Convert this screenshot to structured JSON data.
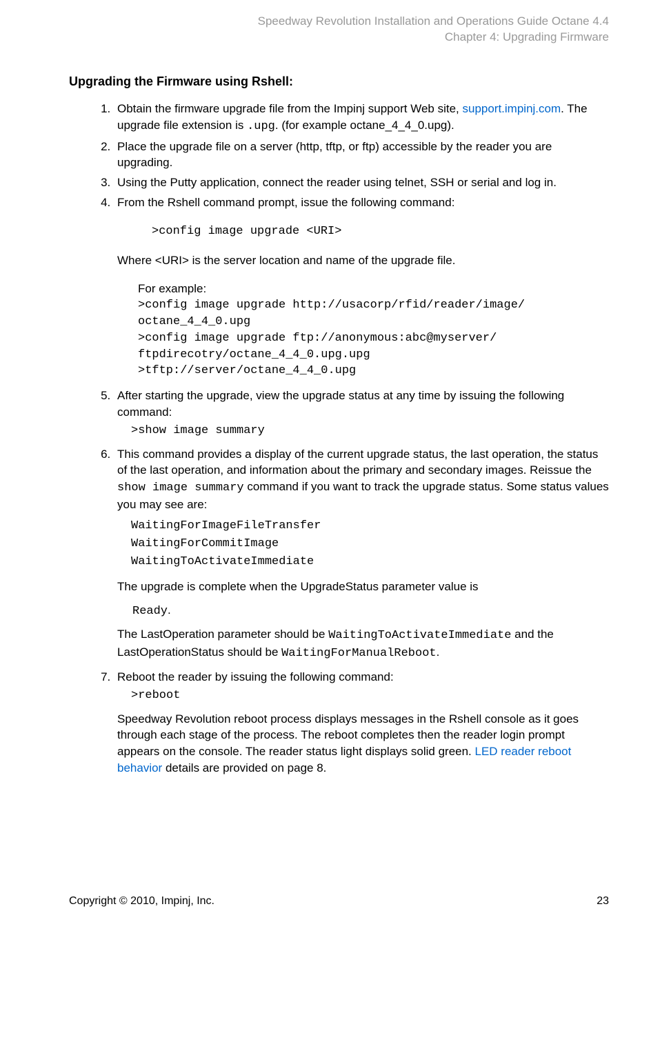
{
  "header": {
    "line1": "Speedway Revolution Installation and Operations Guide Octane 4.4",
    "line2": "Chapter 4: Upgrading Firmware"
  },
  "title": "Upgrading the Firmware using Rshell:",
  "steps": {
    "s1a": "Obtain the firmware upgrade file from the Impinj support Web site, ",
    "s1link": "support.impinj.com",
    "s1b": ". The upgrade file extension is ",
    "s1code": ".upg",
    "s1c": ". (for example octane_4_4_0.upg).",
    "s2": "Place the upgrade file on a server (http, tftp, or ftp) accessible by the reader you are upgrading.",
    "s3": "Using the Putty application, connect the reader using telnet, SSH or serial and log in.",
    "s4": "From the Rshell command prompt, issue the following command:",
    "s4cmd": ">config image upgrade <URI>",
    "s4where": "Where <URI> is the server location and name of the upgrade file.",
    "s4example_label": "For example:",
    "s4ex1": ">config image upgrade http://usacorp/rfid/reader/image/ octane_4_4_0.upg",
    "s4ex2": ">config image upgrade ftp://anonymous:abc@myserver/ ftpdirecotry/octane_4_4_0.upg.upg",
    "s4ex3": ">tftp://server/octane_4_4_0.upg",
    "s5": "After starting the upgrade, view the upgrade status at any time by issuing the following command:",
    "s5cmd": ">show image summary",
    "s6a": "This command provides a display of the current upgrade status, the last operation, the status of the last operation, and information about the primary and secondary images. Reissue the ",
    "s6code": "show image summary",
    "s6b": " command if you want to track the upgrade status. Some status values you may see are:",
    "s6st1": "WaitingForImageFileTransfer",
    "s6st2": "WaitingForCommitImage",
    "s6st3": "WaitingToActivateImmediate",
    "s6c": "The upgrade is complete when the UpgradeStatus parameter value is",
    "s6ready": " Ready",
    "s6dot": ".",
    "s6d1": "The LastOperation parameter should be ",
    "s6d1code": "WaitingToActivateImmediate",
    "s6d2": " and the LastOperationStatus should be ",
    "s6d2code": "WaitingForManualReboot",
    "s6d3": ".",
    "s7": "Reboot the reader by issuing the following command:",
    "s7cmd": ">reboot",
    "s7a": "Speedway Revolution reboot process displays messages in the Rshell console as it goes through each stage of the process. The reboot completes then the reader login prompt appears on the console. The reader status light displays solid green. ",
    "s7link": "LED reader reboot behavior",
    "s7b": " details are provided on page 8."
  },
  "footer": {
    "copyright": "Copyright © 2010, Impinj, Inc.",
    "page": "23"
  }
}
